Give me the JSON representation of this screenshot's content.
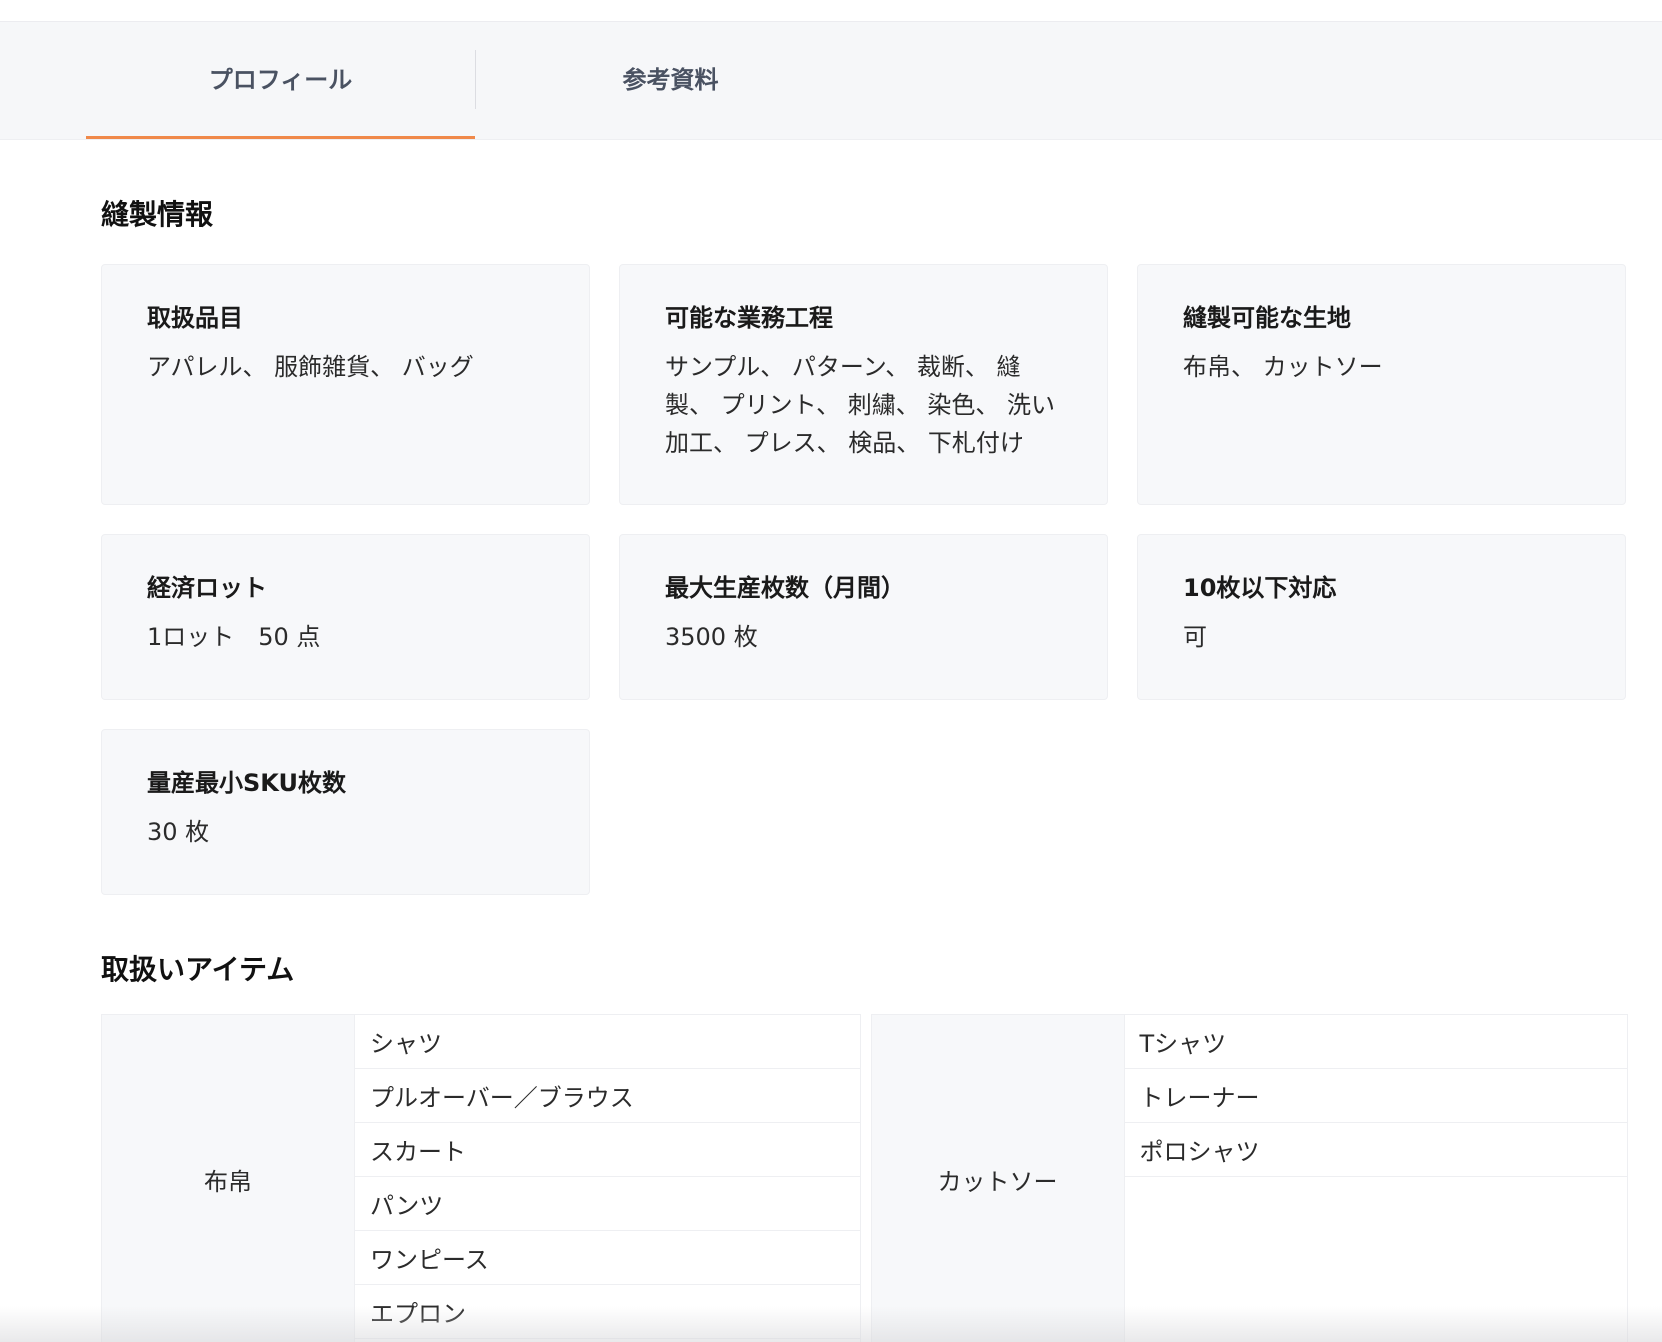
{
  "tabs": [
    {
      "label": "プロフィール",
      "active": true
    },
    {
      "label": "参考資料",
      "active": false
    }
  ],
  "sewing_section": {
    "title": "縫製情報",
    "cards": [
      {
        "label": "取扱品目",
        "value": "アパレル、 服飾雑貨、 バッグ"
      },
      {
        "label": "可能な業務工程",
        "value": "サンプル、 パターン、 裁断、 縫製、 プリント、 刺繍、 染色、 洗い加工、 プレス、 検品、 下札付け"
      },
      {
        "label": "縫製可能な生地",
        "value": "布帛、 カットソー"
      },
      {
        "label": "経済ロット",
        "value": "1ロット　50 点"
      },
      {
        "label": "最大生産枚数（月間）",
        "value": "3500 枚"
      },
      {
        "label": "10枚以下対応",
        "value": "可"
      },
      {
        "label": "量産最小SKU枚数",
        "value": "30 枚"
      }
    ]
  },
  "items_section": {
    "title": "取扱いアイテム",
    "groups": [
      {
        "category": "布帛",
        "items": [
          "シャツ",
          "プルオーバー／ブラウス",
          "スカート",
          "パンツ",
          "ワンピース",
          "エプロン"
        ]
      },
      {
        "category": "カットソー",
        "items": [
          "Tシャツ",
          "トレーナー",
          "ポロシャツ"
        ]
      }
    ]
  },
  "colors": {
    "accent": "#f0894a",
    "card_bg": "#f7f8fa",
    "tab_bg": "#f6f7f9"
  }
}
